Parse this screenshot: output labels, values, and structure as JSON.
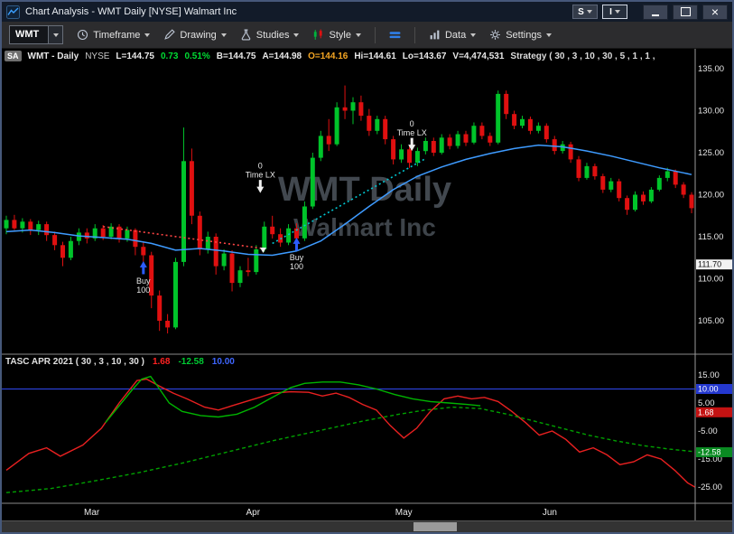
{
  "window": {
    "title": "Chart Analysis - WMT Daily [NYSE] Walmart Inc",
    "btn_s": "S",
    "btn_i": "I"
  },
  "toolbar": {
    "symbol_value": "WMT",
    "timeframe": "Timeframe",
    "drawing": "Drawing",
    "studies": "Studies",
    "style": "Style",
    "data": "Data",
    "settings": "Settings"
  },
  "quote": {
    "badge": "SA",
    "symbol": "WMT - Daily",
    "exchange": "NYSE",
    "last": "L=144.75",
    "change": "0.73",
    "change_pct": "0.51%",
    "bid": "B=144.75",
    "ask": "A=144.98",
    "open": "O=144.16",
    "high": "Hi=144.61",
    "low": "Lo=143.67",
    "volume": "V=4,474,531",
    "strategy": "Strategy ( 30 , 3 , 10 , 30 , 5 , 1 , 1 ,"
  },
  "indicator_header": {
    "name": "TASC APR 2021 ( 30 , 3 , 10 , 30 )",
    "value1": "1.68",
    "value2": "-12.58",
    "value3": "10.00"
  },
  "chart_data": {
    "type": "candlestick",
    "symbol": "WMT",
    "interval": "Daily",
    "watermark": [
      "WMT Daily",
      "Walmart Inc"
    ],
    "colors": {
      "up": "#00c42a",
      "down": "#e01010",
      "ma": "#3e9bff"
    },
    "x_month_labels": [
      {
        "label": "Mar",
        "bar": 10.6
      },
      {
        "label": "Apr",
        "bar": 30.6
      },
      {
        "label": "May",
        "bar": 49.3
      },
      {
        "label": "Jun",
        "bar": 67.4
      }
    ],
    "main_pane": {
      "y_ticks": [
        135,
        130,
        125,
        120,
        115,
        110,
        105
      ],
      "ylim": [
        102.6,
        137.4
      ],
      "price_marker": {
        "text": "111.70",
        "value": 111.7
      },
      "candles_ohlc": [
        [
          116.0,
          117.5,
          115.3,
          117.0
        ],
        [
          117.0,
          117.6,
          115.8,
          116.0
        ],
        [
          116.0,
          117.2,
          115.5,
          116.8
        ],
        [
          116.8,
          117.1,
          115.2,
          115.8
        ],
        [
          115.8,
          116.9,
          115.2,
          116.5
        ],
        [
          116.5,
          116.8,
          114.5,
          115.2
        ],
        [
          115.2,
          115.6,
          113.4,
          114.0
        ],
        [
          114.0,
          114.4,
          111.5,
          112.5
        ],
        [
          112.5,
          115.0,
          112.2,
          114.5
        ],
        [
          114.5,
          116.0,
          114.0,
          115.5
        ],
        [
          115.5,
          116.0,
          114.2,
          114.8
        ],
        [
          114.8,
          116.5,
          114.5,
          116.0
        ],
        [
          116.0,
          116.4,
          114.6,
          115.0
        ],
        [
          115.0,
          116.6,
          114.7,
          116.2
        ],
        [
          116.2,
          116.5,
          114.3,
          114.8
        ],
        [
          114.8,
          116.2,
          114.4,
          115.8
        ],
        [
          115.8,
          116.0,
          112.8,
          113.8
        ],
        [
          113.8,
          114.3,
          112.0,
          112.8
        ],
        [
          112.8,
          113.2,
          106.5,
          108.0
        ],
        [
          108.0,
          108.6,
          103.8,
          105.0
        ],
        [
          105.0,
          105.8,
          103.5,
          104.2
        ],
        [
          104.2,
          112.5,
          104.0,
          112.0
        ],
        [
          112.0,
          128.0,
          111.5,
          124.0
        ],
        [
          124.0,
          125.5,
          116.5,
          117.5
        ],
        [
          117.5,
          118.0,
          112.8,
          113.5
        ],
        [
          113.5,
          115.6,
          113.0,
          115.0
        ],
        [
          115.0,
          115.4,
          110.5,
          111.5
        ],
        [
          111.5,
          113.5,
          111.0,
          113.0
        ],
        [
          113.0,
          113.4,
          108.5,
          109.5
        ],
        [
          109.5,
          111.5,
          109.0,
          111.0
        ],
        [
          111.0,
          112.5,
          110.3,
          110.8
        ],
        [
          110.8,
          114.0,
          110.5,
          113.5
        ],
        [
          113.5,
          116.8,
          113.2,
          116.2
        ],
        [
          116.2,
          117.5,
          114.8,
          115.3
        ],
        [
          115.3,
          116.0,
          113.8,
          114.3
        ],
        [
          114.3,
          116.5,
          114.0,
          116.0
        ],
        [
          116.0,
          116.6,
          114.2,
          114.8
        ],
        [
          114.8,
          119.2,
          114.5,
          118.6
        ],
        [
          118.6,
          125.0,
          118.3,
          124.4
        ],
        [
          124.4,
          127.6,
          124.0,
          127.0
        ],
        [
          127.0,
          129.0,
          125.2,
          126.0
        ],
        [
          126.0,
          131.0,
          125.8,
          130.4
        ],
        [
          130.4,
          133.0,
          129.0,
          130.0
        ],
        [
          130.0,
          131.6,
          128.4,
          131.0
        ],
        [
          131.0,
          131.8,
          128.8,
          129.4
        ],
        [
          129.4,
          130.2,
          127.0,
          127.6
        ],
        [
          127.6,
          129.4,
          127.2,
          129.0
        ],
        [
          129.0,
          129.4,
          126.0,
          126.6
        ],
        [
          126.6,
          127.0,
          123.6,
          124.2
        ],
        [
          124.2,
          126.0,
          123.8,
          125.4
        ],
        [
          125.4,
          125.8,
          123.2,
          123.8
        ],
        [
          123.8,
          125.6,
          123.4,
          125.2
        ],
        [
          125.2,
          126.8,
          124.8,
          126.4
        ],
        [
          126.4,
          126.8,
          124.6,
          125.0
        ],
        [
          125.0,
          127.2,
          124.8,
          126.8
        ],
        [
          126.8,
          127.2,
          125.4,
          125.8
        ],
        [
          125.8,
          127.6,
          125.5,
          127.2
        ],
        [
          127.2,
          127.6,
          125.8,
          126.2
        ],
        [
          126.2,
          128.6,
          126.0,
          128.2
        ],
        [
          128.2,
          128.6,
          126.6,
          127.0
        ],
        [
          127.0,
          127.4,
          125.8,
          126.2
        ],
        [
          126.2,
          132.4,
          126.0,
          132.0
        ],
        [
          132.0,
          132.4,
          129.0,
          129.6
        ],
        [
          129.6,
          130.0,
          127.8,
          128.2
        ],
        [
          128.2,
          129.4,
          127.9,
          129.0
        ],
        [
          129.0,
          129.3,
          127.2,
          127.6
        ],
        [
          127.6,
          128.6,
          127.3,
          128.2
        ],
        [
          128.2,
          128.5,
          126.2,
          126.6
        ],
        [
          126.6,
          127.0,
          124.8,
          125.2
        ],
        [
          125.2,
          126.4,
          124.9,
          126.0
        ],
        [
          126.0,
          126.3,
          123.8,
          124.2
        ],
        [
          124.2,
          124.6,
          121.6,
          122.0
        ],
        [
          122.0,
          123.8,
          121.8,
          123.4
        ],
        [
          123.4,
          123.7,
          121.8,
          122.2
        ],
        [
          122.2,
          122.5,
          120.2,
          120.6
        ],
        [
          120.6,
          122.0,
          120.3,
          121.6
        ],
        [
          121.6,
          121.9,
          119.2,
          119.6
        ],
        [
          119.6,
          119.9,
          117.6,
          118.2
        ],
        [
          118.2,
          120.4,
          118.0,
          120.0
        ],
        [
          120.0,
          120.4,
          118.8,
          119.2
        ],
        [
          119.2,
          120.9,
          119.0,
          120.6
        ],
        [
          120.6,
          122.3,
          120.4,
          122.0
        ],
        [
          122.0,
          123.2,
          121.6,
          122.8
        ],
        [
          122.8,
          123.0,
          120.8,
          121.2
        ],
        [
          121.2,
          121.5,
          119.6,
          120.0
        ],
        [
          120.0,
          120.3,
          117.8,
          118.4
        ]
      ],
      "ma_points": [
        [
          0,
          115.6
        ],
        [
          3,
          115.8
        ],
        [
          6,
          115.5
        ],
        [
          9,
          115.1
        ],
        [
          12,
          114.9
        ],
        [
          15,
          114.7
        ],
        [
          18,
          114.2
        ],
        [
          21,
          113.4
        ],
        [
          24,
          113.6
        ],
        [
          27,
          113.3
        ],
        [
          30,
          112.9
        ],
        [
          33,
          112.8
        ],
        [
          36,
          113.3
        ],
        [
          39,
          114.5
        ],
        [
          42,
          116.5
        ],
        [
          45,
          118.6
        ],
        [
          48,
          120.6
        ],
        [
          51,
          122.2
        ],
        [
          54,
          123.3
        ],
        [
          57,
          124.2
        ],
        [
          60,
          124.9
        ],
        [
          63,
          125.5
        ],
        [
          66,
          125.9
        ],
        [
          69,
          125.7
        ],
        [
          72,
          125.2
        ],
        [
          75,
          124.6
        ],
        [
          78,
          123.9
        ],
        [
          81,
          123.2
        ],
        [
          84,
          122.6
        ],
        [
          85,
          122.4
        ]
      ],
      "trails": [
        {
          "name": "short-exit-trail",
          "color": "#ff4545",
          "end_arrow": true,
          "points": [
            [
              12,
              116.2
            ],
            [
              31.8,
              113.6
            ]
          ]
        },
        {
          "name": "long-entry-trail",
          "color": "#00c8d2",
          "end_arrow": false,
          "points": [
            [
              33,
              114.2
            ],
            [
              52,
              124.3
            ]
          ]
        }
      ],
      "trade_markers": [
        {
          "type": "buy",
          "bar": 17,
          "price": 112.1,
          "lines": [
            "Buy",
            "100"
          ]
        },
        {
          "type": "buy",
          "bar": 36,
          "price": 114.9,
          "lines": [
            "Buy",
            "100"
          ]
        },
        {
          "type": "exit",
          "bar": 31.5,
          "price": 120.2,
          "lines": [
            "0",
            "Time LX"
          ]
        },
        {
          "type": "exit",
          "bar": 50.3,
          "price": 125.2,
          "lines": [
            "0",
            "Time LX"
          ]
        }
      ]
    },
    "indicator_pane": {
      "name": "TASC APR 2021",
      "params": [
        30,
        3,
        10,
        30
      ],
      "y_ticks": [
        15,
        5,
        -5,
        -15,
        -25
      ],
      "ylim": [
        -30,
        17
      ],
      "threshold": {
        "value": 10,
        "color": "#2a3fd4"
      },
      "series": [
        {
          "name": "fast-red-line",
          "color": "#e82020",
          "dash": "",
          "points": [
            [
              0,
              -19
            ],
            [
              2.8,
              -13
            ],
            [
              5,
              -11
            ],
            [
              6.7,
              -14
            ],
            [
              9.5,
              -10
            ],
            [
              11.8,
              -4
            ],
            [
              14,
              5
            ],
            [
              16.2,
              13
            ],
            [
              17.4,
              13.5
            ],
            [
              19,
              11
            ],
            [
              20.7,
              8.5
            ],
            [
              22.4,
              6.5
            ],
            [
              24.6,
              3.5
            ],
            [
              26.3,
              2.5
            ],
            [
              28,
              4
            ],
            [
              29.7,
              5.5
            ],
            [
              31.4,
              7
            ],
            [
              33,
              8.5
            ],
            [
              35.3,
              9
            ],
            [
              37.5,
              8.8
            ],
            [
              39.2,
              7.5
            ],
            [
              40.9,
              8.5
            ],
            [
              42.5,
              7
            ],
            [
              44.2,
              4.5
            ],
            [
              45.9,
              2.5
            ],
            [
              47.6,
              -3
            ],
            [
              49.3,
              -7.5
            ],
            [
              50.9,
              -4
            ],
            [
              52.6,
              2
            ],
            [
              54.3,
              6.5
            ],
            [
              56,
              7.5
            ],
            [
              57.7,
              6.5
            ],
            [
              59.3,
              7
            ],
            [
              61,
              5.5
            ],
            [
              62.7,
              2
            ],
            [
              64.4,
              -2
            ],
            [
              66.1,
              -6.5
            ],
            [
              67.7,
              -5
            ],
            [
              69.4,
              -8
            ],
            [
              71.1,
              -12.5
            ],
            [
              72.8,
              -11
            ],
            [
              74.5,
              -13.5
            ],
            [
              76.1,
              -17
            ],
            [
              77.8,
              -16
            ],
            [
              79.5,
              -13.5
            ],
            [
              81.2,
              -15
            ],
            [
              82.9,
              -19
            ],
            [
              84.5,
              -23.5
            ],
            [
              85.4,
              -25
            ]
          ]
        },
        {
          "name": "green-solid-line",
          "color": "#00b400",
          "dash": "",
          "points": [
            [
              12.3,
              -2
            ],
            [
              14,
              4
            ],
            [
              15.7,
              10
            ],
            [
              16.8,
              13.5
            ],
            [
              17.9,
              14.5
            ],
            [
              19,
              10
            ],
            [
              20.2,
              5
            ],
            [
              21.8,
              2
            ],
            [
              24.1,
              0.5
            ],
            [
              26.3,
              0
            ],
            [
              28.6,
              1
            ],
            [
              30.8,
              3.5
            ],
            [
              33,
              7
            ],
            [
              35.3,
              10.5
            ],
            [
              37,
              12
            ],
            [
              39.2,
              12.5
            ],
            [
              41.4,
              12.5
            ],
            [
              43.7,
              11.5
            ],
            [
              45.9,
              10
            ],
            [
              48.2,
              8
            ],
            [
              50.4,
              6.5
            ],
            [
              52.6,
              5.5
            ],
            [
              54.9,
              5
            ],
            [
              57.1,
              4.5
            ],
            [
              58.8,
              4
            ]
          ]
        },
        {
          "name": "green-dashed-line",
          "color": "#00a000",
          "dash": "4,3",
          "points": [
            [
              0,
              -27
            ],
            [
              5.6,
              -25.5
            ],
            [
              10.6,
              -23
            ],
            [
              16.2,
              -20
            ],
            [
              21.8,
              -16.5
            ],
            [
              27.4,
              -12.5
            ],
            [
              33,
              -8.5
            ],
            [
              38.6,
              -5
            ],
            [
              44.2,
              -1.5
            ],
            [
              48.7,
              1
            ],
            [
              52,
              2.5
            ],
            [
              55.4,
              3.5
            ],
            [
              58.8,
              3
            ],
            [
              62.1,
              1
            ],
            [
              65.5,
              -1.5
            ],
            [
              68.9,
              -4
            ],
            [
              72.2,
              -6.5
            ],
            [
              75.6,
              -8.5
            ],
            [
              78.9,
              -10.2
            ],
            [
              82.3,
              -11.5
            ],
            [
              85.4,
              -12.4
            ]
          ]
        }
      ],
      "value_badges": [
        {
          "text": "10.00",
          "value": 10,
          "color": "#2438cf"
        },
        {
          "text": "1.68",
          "value": 1.68,
          "color": "#c41212"
        },
        {
          "text": "-12.58",
          "value": -12.58,
          "color": "#0a8a22"
        }
      ]
    }
  }
}
